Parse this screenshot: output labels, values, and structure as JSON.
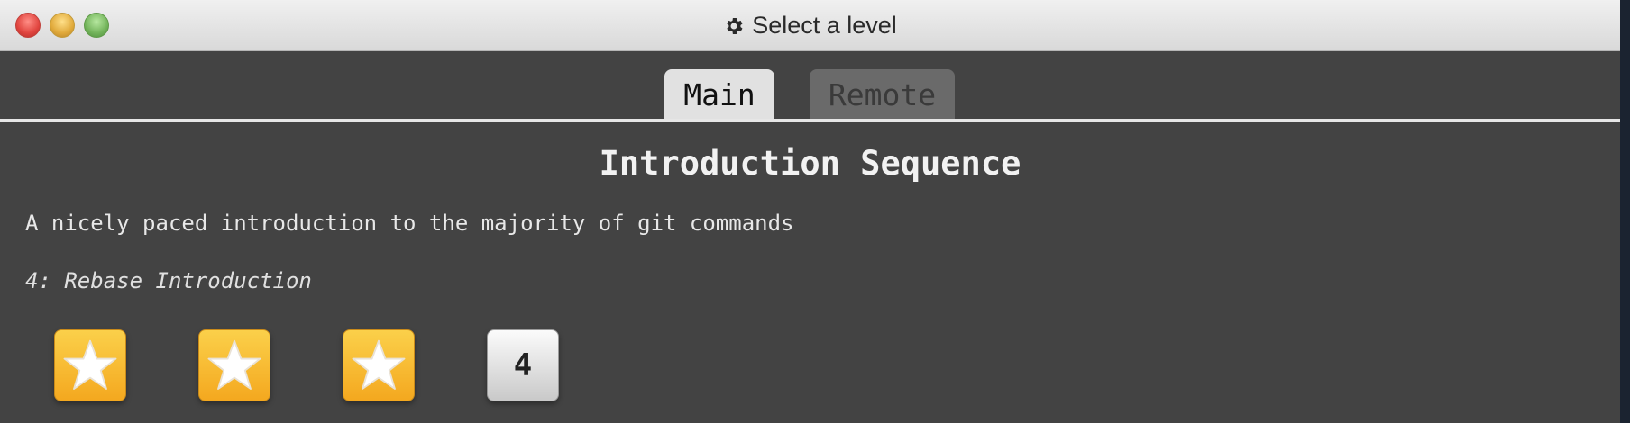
{
  "window": {
    "title": "Select a level",
    "title_icon": "gear-icon"
  },
  "tabs": [
    {
      "label": "Main",
      "active": true
    },
    {
      "label": "Remote",
      "active": false
    }
  ],
  "sequence": {
    "title": "Introduction Sequence",
    "description": "A nicely paced introduction to the majority of git commands",
    "selected_level": "4: Rebase Introduction"
  },
  "levels": [
    {
      "state": "solved",
      "icon": "star-icon"
    },
    {
      "state": "solved",
      "icon": "star-icon"
    },
    {
      "state": "solved",
      "icon": "star-icon"
    },
    {
      "state": "current",
      "label": "4"
    }
  ],
  "colors": {
    "background": "#434343",
    "solved_level": "#f4a81f",
    "active_tab": "#e1e1e1",
    "inactive_tab": "#6a6a6a"
  }
}
